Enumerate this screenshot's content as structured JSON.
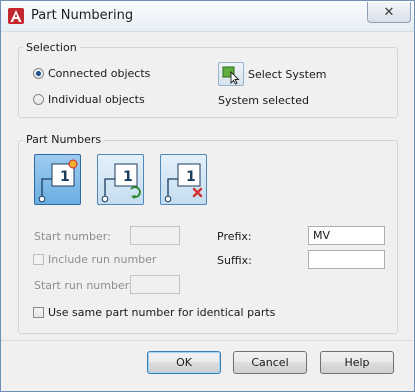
{
  "window": {
    "title": "Part Numbering",
    "close_glyph": "✕"
  },
  "selection": {
    "group_title": "Selection",
    "radio_connected": "Connected objects",
    "radio_individual": "Individual objects",
    "selected_option": "Connected objects",
    "select_system_label": "Select System",
    "status": "System selected"
  },
  "part_numbers": {
    "group_title": "Part Numbers",
    "tools": [
      {
        "name": "assign",
        "icon": "part-number-assign-icon",
        "active": true
      },
      {
        "name": "renumber",
        "icon": "part-number-renumber-icon",
        "active": false
      },
      {
        "name": "remove",
        "icon": "part-number-remove-icon",
        "active": false
      }
    ],
    "tool_number_glyph": "1",
    "start_number_label": "Start number:",
    "start_number_value": "",
    "include_run_label": "Include run number",
    "include_run_checked": false,
    "start_run_label": "Start run number:",
    "start_run_value": "",
    "prefix_label": "Prefix:",
    "prefix_value": "MV",
    "suffix_label": "Suffix:",
    "suffix_value": "",
    "same_number_label": "Use same part number for identical parts",
    "same_number_checked": false
  },
  "buttons": {
    "ok": "OK",
    "cancel": "Cancel",
    "help": "Help"
  },
  "colors": {
    "accent": "#6aaee2",
    "brand_red": "#c4262e",
    "border_blue": "#4f88b8"
  }
}
